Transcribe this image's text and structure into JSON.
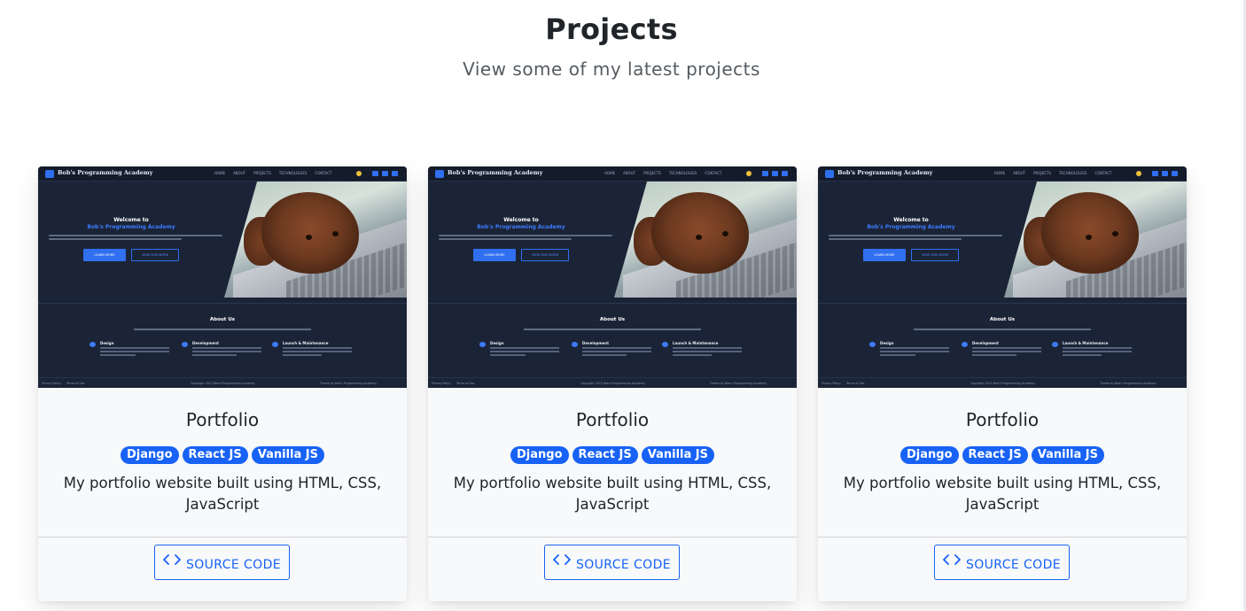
{
  "header": {
    "title": "Projects",
    "subtitle": "View some of my latest projects"
  },
  "thumbnail": {
    "brand": "Bob's Programming Academy",
    "nav": [
      "HOME",
      "ABOUT",
      "PROJECTS",
      "TECHNOLOGIES",
      "CONTACT"
    ],
    "welcome": "Welcome to",
    "welcome_name": "Bob's Programming Academy",
    "btn_primary": "LEARN MORE",
    "btn_secondary": "VIEW OUR WORK",
    "about_title": "About Us",
    "features": [
      "Design",
      "Development",
      "Launch & Maintenance"
    ],
    "footer_left1": "Privacy Policy",
    "footer_left2": "Terms of Use",
    "footer_center": "Copyright 2023 Bob's Programming Academy",
    "footer_right": "Theme by Bob's Programming Academy"
  },
  "projects": [
    {
      "title": "Portfolio",
      "tags": [
        "Django",
        "React JS",
        "Vanilla JS"
      ],
      "description": "My portfolio website built using HTML, CSS, JavaScript",
      "button_label": "SOURCE CODE",
      "icon": "code-icon"
    },
    {
      "title": "Portfolio",
      "tags": [
        "Django",
        "React JS",
        "Vanilla JS"
      ],
      "description": "My portfolio website built using HTML, CSS, JavaScript",
      "button_label": "SOURCE CODE",
      "icon": "code-icon"
    },
    {
      "title": "Portfolio",
      "tags": [
        "Django",
        "React JS",
        "Vanilla JS"
      ],
      "description": "My portfolio website built using HTML, CSS, JavaScript",
      "button_label": "SOURCE CODE",
      "icon": "code-icon"
    }
  ],
  "colors": {
    "accent": "#1862f6",
    "card_bg": "#f8f9fa",
    "thumb_bg": "#1b2436"
  }
}
